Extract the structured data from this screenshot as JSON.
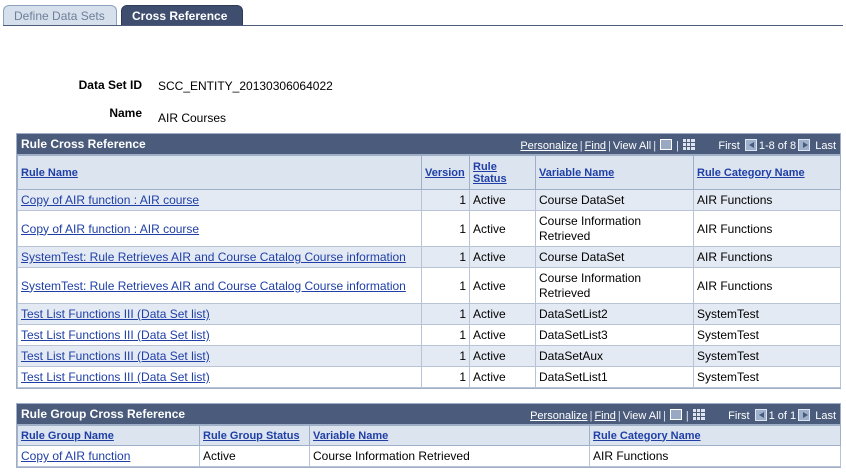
{
  "tabs": [
    {
      "label": "Define Data Sets",
      "active": false
    },
    {
      "label": "Cross Reference",
      "active": true
    }
  ],
  "header": {
    "data_set_id_label": "Data Set ID",
    "data_set_id_value": "SCC_ENTITY_20130306064022",
    "name_label": "Name",
    "name_value": "AIR Courses"
  },
  "rule_xref": {
    "title": "Rule Cross Reference",
    "personalize": "Personalize",
    "find": "Find",
    "view_all": "View All",
    "first": "First",
    "range": "1-8 of 8",
    "last": "Last",
    "columns": {
      "rule_name": "Rule Name",
      "version": "Version",
      "rule_status": "Rule Status",
      "variable_name": "Variable Name",
      "rule_category": "Rule Category Name"
    },
    "rows": [
      {
        "rule_name": "Copy of AIR function : AIR course",
        "version": "1",
        "status": "Active",
        "variable": "Course DataSet",
        "category": "AIR Functions"
      },
      {
        "rule_name": "Copy of AIR function : AIR course",
        "version": "1",
        "status": "Active",
        "variable": "Course Information Retrieved",
        "category": "AIR Functions"
      },
      {
        "rule_name": "SystemTest: Rule Retrieves AIR and Course Catalog Course information",
        "version": "1",
        "status": "Active",
        "variable": "Course DataSet",
        "category": "AIR Functions"
      },
      {
        "rule_name": "SystemTest: Rule Retrieves AIR and Course Catalog Course information",
        "version": "1",
        "status": "Active",
        "variable": "Course Information Retrieved",
        "category": "AIR Functions"
      },
      {
        "rule_name": "Test List Functions III (Data Set list)",
        "version": "1",
        "status": "Active",
        "variable": "DataSetList2",
        "category": "SystemTest"
      },
      {
        "rule_name": "Test List Functions III (Data Set list)",
        "version": "1",
        "status": "Active",
        "variable": "DataSetList3",
        "category": "SystemTest"
      },
      {
        "rule_name": "Test List Functions III (Data Set list)",
        "version": "1",
        "status": "Active",
        "variable": "DataSetAux",
        "category": "SystemTest"
      },
      {
        "rule_name": "Test List Functions III (Data Set list)",
        "version": "1",
        "status": "Active",
        "variable": "DataSetList1",
        "category": "SystemTest"
      }
    ]
  },
  "group_xref": {
    "title": "Rule Group Cross Reference",
    "personalize": "Personalize",
    "find": "Find",
    "view_all": "View All",
    "first": "First",
    "range": "1 of 1",
    "last": "Last",
    "columns": {
      "group_name": "Rule Group Name",
      "group_status": "Rule Group Status",
      "variable_name": "Variable Name",
      "rule_category": "Rule Category Name"
    },
    "rows": [
      {
        "group_name": "Copy of AIR function",
        "status": "Active",
        "variable": "Course Information Retrieved",
        "category": "AIR Functions"
      }
    ]
  }
}
